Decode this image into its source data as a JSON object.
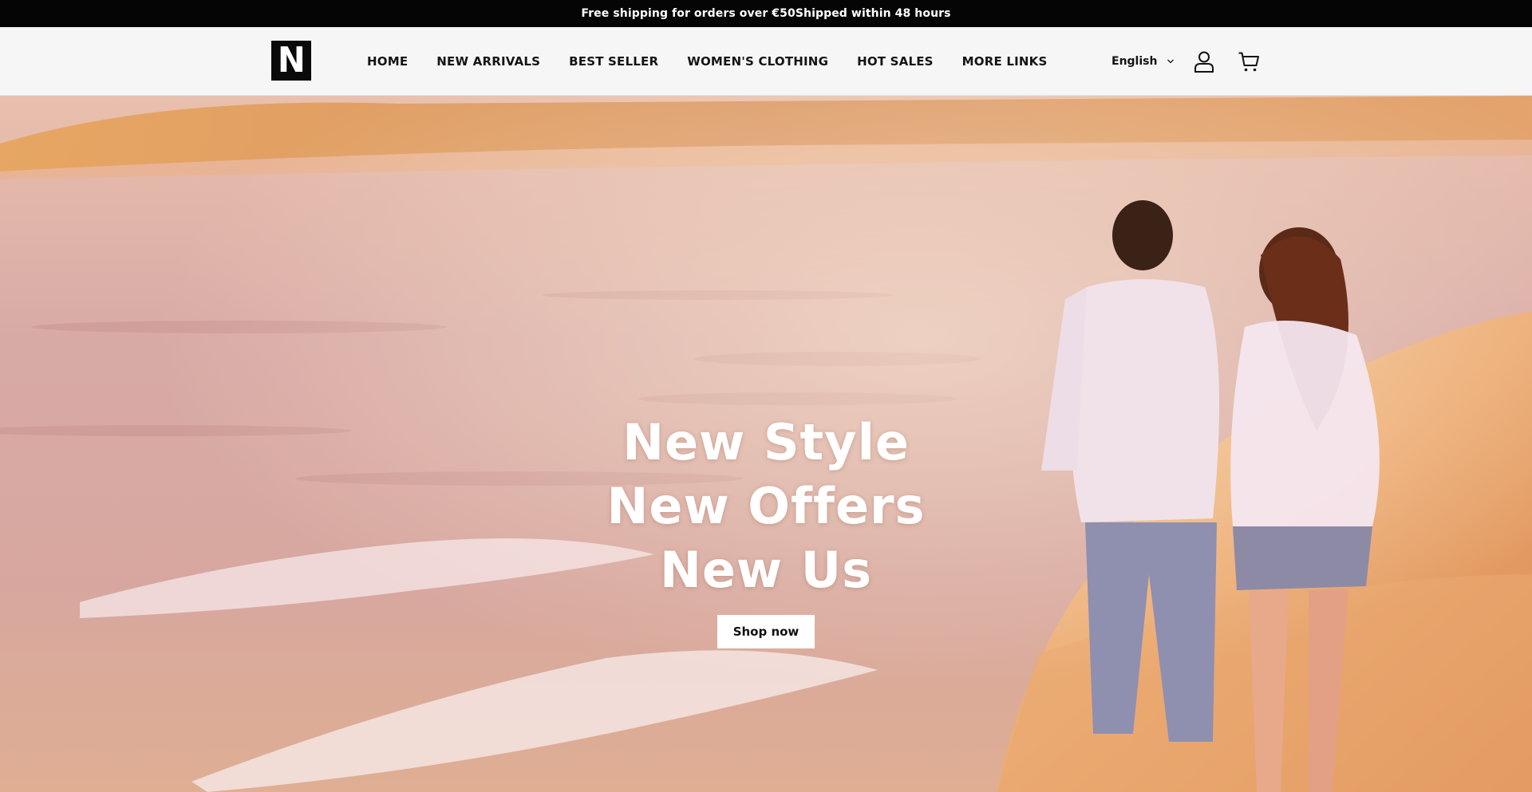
{
  "announcement": {
    "text": "Free shipping for orders over €50Shipped within 48 hours"
  },
  "header": {
    "logo_letter": "N",
    "nav": [
      {
        "label": "HOME"
      },
      {
        "label": "NEW ARRIVALS"
      },
      {
        "label": "BEST SELLER"
      },
      {
        "label": "WOMEN'S CLOTHING"
      },
      {
        "label": "HOT SALES"
      },
      {
        "label": "MORE LINKS"
      }
    ],
    "language": "English",
    "icons": {
      "language_chevron": "chevron-down-icon",
      "account": "user-icon",
      "cart": "cart-icon"
    }
  },
  "hero": {
    "lines": [
      "New Style",
      "New Offers",
      "New Us"
    ],
    "button_label": "Shop now",
    "image": "beach-couple-sunset"
  },
  "colors": {
    "announcement_bg": "#050505",
    "header_bg": "#f6f6f6",
    "text_dark": "#141414",
    "hero_text": "#ffffff"
  }
}
